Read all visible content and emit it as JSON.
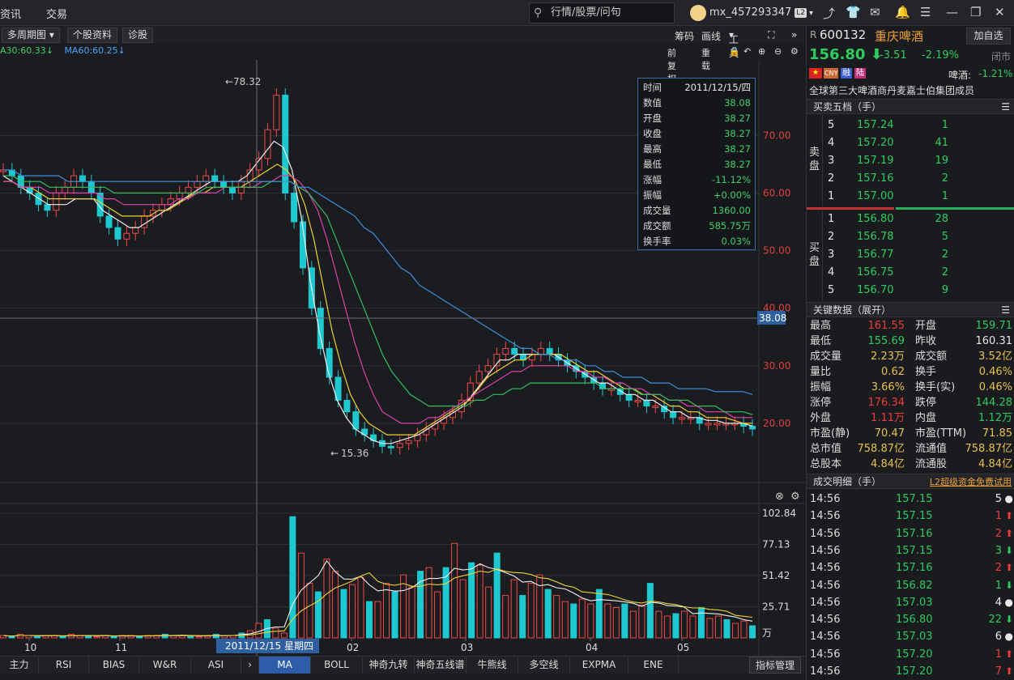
{
  "topnav": {
    "item1": "资讯",
    "item2": "交易"
  },
  "search": {
    "placeholder": "行情/股票/问句"
  },
  "user": {
    "name": "mx_457293347",
    "level": "L2"
  },
  "toolbar": {
    "period": "多周期图",
    "profile": "个股资料",
    "diagnose": "诊股",
    "chips": "筹码",
    "drawline": "画线",
    "tools": "工具"
  },
  "ma": {
    "ma30": "A30:60.33",
    "ma60": "MA60:60.25"
  },
  "chartctrl": {
    "restore": "前复权",
    "overlay": "重载"
  },
  "chart_data": {
    "type": "candlestick",
    "price_axis": [
      "70.00",
      "60.00",
      "50.00",
      "40.00",
      "30.00",
      "20.00"
    ],
    "current_price_label": "38.08",
    "high_marker": "78.32",
    "low_marker": "15.36",
    "volume_axis": [
      "102.84",
      "77.13",
      "51.42",
      "25.71",
      "万"
    ],
    "x_ticks": [
      "10",
      "11",
      "02",
      "03",
      "04",
      "05"
    ],
    "cursor_date": "2011/12/15 星期四",
    "series": [
      {
        "name": "close",
        "values": [
          64,
          63,
          61,
          60,
          58,
          57,
          60,
          61,
          63,
          62,
          60,
          56,
          54,
          52,
          53,
          54,
          56,
          57,
          58,
          59,
          60,
          61,
          62,
          63,
          62,
          61,
          60,
          62,
          64,
          66,
          71,
          77,
          60,
          55,
          47,
          40,
          33,
          28,
          24,
          22,
          19,
          18,
          17,
          16,
          15.8,
          16.5,
          17,
          18,
          19,
          20,
          21,
          22,
          24,
          27,
          29,
          30,
          32,
          33,
          32,
          31,
          32,
          33,
          32,
          31,
          30,
          29,
          28,
          27,
          26,
          26,
          25,
          24,
          24,
          23,
          23,
          22,
          21,
          21,
          21,
          20,
          20,
          20,
          20,
          20,
          19.5,
          19
        ]
      },
      {
        "name": "ma_white",
        "values": [
          63,
          62,
          61,
          60,
          59,
          58,
          58,
          58,
          59,
          59,
          59,
          57,
          56,
          55,
          54,
          54,
          55,
          56,
          57,
          58,
          59,
          60,
          61,
          62,
          62,
          62,
          62,
          63,
          65,
          67,
          69,
          68,
          64,
          56,
          45,
          36,
          29,
          24,
          21,
          19,
          18,
          17,
          16.5,
          16.5,
          17,
          17.5,
          18,
          19,
          20,
          21,
          22,
          23,
          25,
          27,
          29,
          31,
          31,
          32,
          32,
          32,
          32,
          32,
          31,
          30,
          29,
          28,
          27,
          27,
          26,
          25,
          25,
          24,
          24,
          23,
          22,
          22,
          21,
          21,
          20.5,
          20.5,
          20,
          20,
          20,
          19.5
        ]
      },
      {
        "name": "ma_yellow",
        "values": [
          62,
          62,
          61,
          61,
          60,
          59,
          59,
          59,
          59,
          59,
          59,
          58,
          57,
          56,
          56,
          56,
          56,
          57,
          57,
          58,
          59,
          60,
          60,
          61,
          61,
          61,
          61,
          62,
          63,
          64,
          65,
          64,
          62,
          58,
          52,
          44,
          36,
          30,
          25,
          22,
          20,
          19,
          18,
          18,
          18,
          18,
          19,
          20,
          21,
          22,
          23,
          24,
          26,
          28,
          29,
          30,
          31,
          31,
          32,
          32,
          32,
          32,
          31,
          30,
          29,
          29,
          28,
          27,
          26,
          26,
          25,
          25,
          24,
          23,
          23,
          22,
          22,
          21,
          21,
          21,
          20.5,
          20,
          20
        ]
      },
      {
        "name": "ma_pink",
        "values": [
          62,
          62,
          61,
          61,
          61,
          60,
          60,
          60,
          60,
          60,
          60,
          59,
          59,
          58,
          58,
          58,
          58,
          58,
          58,
          59,
          59,
          60,
          60,
          60,
          61,
          61,
          61,
          61,
          62,
          62,
          63,
          63,
          62,
          60,
          57,
          52,
          46,
          40,
          34,
          29,
          25,
          22,
          21,
          20,
          20,
          20,
          21,
          21,
          22,
          23,
          24,
          25,
          26,
          27,
          28,
          29,
          29,
          30,
          30,
          30,
          30,
          30,
          29,
          29,
          28,
          28,
          27,
          27,
          26,
          26,
          25,
          25,
          24,
          24,
          23,
          23,
          22,
          22,
          22,
          21,
          21,
          21
        ]
      },
      {
        "name": "ma_green",
        "values": [
          63,
          63,
          62,
          62,
          62,
          61,
          61,
          61,
          61,
          61,
          61,
          61,
          60,
          60,
          60,
          60,
          60,
          60,
          60,
          60,
          60,
          60,
          61,
          61,
          61,
          61,
          61,
          61,
          61,
          62,
          62,
          62,
          61,
          60,
          58,
          56,
          52,
          48,
          44,
          40,
          36,
          32,
          29,
          27,
          25,
          24,
          23,
          23,
          23,
          23,
          23,
          24,
          24,
          25,
          25,
          26,
          26,
          27,
          27,
          27,
          27,
          27,
          27,
          27,
          27,
          26,
          26,
          26,
          26,
          25,
          25,
          25,
          24,
          24,
          24,
          23,
          23,
          23,
          22,
          22,
          22,
          21.5
        ]
      },
      {
        "name": "ma30",
        "values": [
          64,
          64,
          63,
          63,
          63,
          63,
          63,
          62,
          62,
          62,
          62,
          62,
          62,
          62,
          62,
          62,
          62,
          62,
          62,
          62,
          62,
          62,
          62,
          62,
          62,
          62,
          62,
          62,
          62,
          62,
          62,
          62,
          61,
          61,
          60,
          59,
          58,
          57,
          56,
          54,
          53,
          51,
          49,
          47,
          46,
          44,
          43,
          42,
          41,
          40,
          39,
          38,
          37,
          36,
          35,
          34,
          33,
          33,
          32,
          32,
          31,
          31,
          31,
          30,
          30,
          29,
          29,
          28,
          28,
          28,
          27,
          27,
          27,
          26,
          26,
          26,
          26,
          25.5,
          25.5,
          25.5,
          25.5,
          25
        ]
      }
    ],
    "volume": [
      2,
      1,
      3,
      2,
      1,
      2,
      2,
      1,
      3,
      2,
      2,
      1,
      2,
      1,
      2,
      2,
      1,
      2,
      2,
      3,
      2,
      2,
      1,
      1,
      2,
      3,
      2,
      2,
      4,
      6,
      12,
      15,
      8,
      4,
      100,
      70,
      45,
      38,
      65,
      55,
      40,
      44,
      50,
      30,
      30,
      45,
      38,
      52,
      42,
      55,
      58,
      38,
      58,
      78,
      48,
      62,
      60,
      42,
      70,
      35,
      48,
      35,
      45,
      52,
      40,
      35,
      30,
      28,
      32,
      28,
      40,
      28,
      25,
      28,
      22,
      27,
      45,
      22,
      18,
      20,
      22,
      18,
      25,
      16,
      18,
      15,
      12,
      14,
      10
    ]
  },
  "infobox": {
    "rows": [
      {
        "k": "时间",
        "v": "2011/12/15/四"
      },
      {
        "k": "数值",
        "v": "38.08"
      },
      {
        "k": "开盘",
        "v": "38.27"
      },
      {
        "k": "收盘",
        "v": "38.27"
      },
      {
        "k": "最高",
        "v": "38.27"
      },
      {
        "k": "最低",
        "v": "38.27"
      },
      {
        "k": "涨幅",
        "v": "-11.12%"
      },
      {
        "k": "振幅",
        "v": "+0.00%"
      },
      {
        "k": "成交量",
        "v": "1360.00"
      },
      {
        "k": "成交额",
        "v": "585.75万"
      },
      {
        "k": "换手率",
        "v": "0.03%"
      }
    ]
  },
  "tabs": [
    "主力",
    "RSI",
    "BIAS",
    "W&R",
    "ASI",
    "MA",
    "BOLL",
    "神奇九转",
    "神奇五线谱",
    "牛熊线",
    "多空线",
    "EXPMA",
    "ENE"
  ],
  "tabs_right": "指标管理",
  "stock": {
    "flag": "R",
    "code": "600132",
    "name": "重庆啤酒",
    "add": "加自选",
    "price": "156.80",
    "change": "-3.51",
    "pct": "-2.19%",
    "status": "闭市",
    "sector": "啤酒:",
    "sector_pct": "-1.21%",
    "tag_cny": "CNY",
    "tag_rong": "融",
    "tag_lu": "陆",
    "desc": "全球第三大啤酒商丹麦嘉士伯集团成员"
  },
  "orderbook": {
    "title": "买卖五档（手）",
    "sell_label": "卖盘",
    "buy_label": "买盘",
    "sells": [
      {
        "lvl": "5",
        "p": "157.24",
        "v": "1"
      },
      {
        "lvl": "4",
        "p": "157.20",
        "v": "41"
      },
      {
        "lvl": "3",
        "p": "157.19",
        "v": "19"
      },
      {
        "lvl": "2",
        "p": "157.16",
        "v": "2"
      },
      {
        "lvl": "1",
        "p": "157.00",
        "v": "1"
      }
    ],
    "buys": [
      {
        "lvl": "1",
        "p": "156.80",
        "v": "28"
      },
      {
        "lvl": "2",
        "p": "156.78",
        "v": "5"
      },
      {
        "lvl": "3",
        "p": "156.77",
        "v": "2"
      },
      {
        "lvl": "4",
        "p": "156.75",
        "v": "2"
      },
      {
        "lvl": "5",
        "p": "156.70",
        "v": "9"
      }
    ]
  },
  "keydata": {
    "title": "关键数据（展开）",
    "rows": [
      {
        "k1": "最高",
        "v1": "161.55",
        "c1": "red",
        "k2": "开盘",
        "v2": "159.71",
        "c2": "green"
      },
      {
        "k1": "最低",
        "v1": "155.69",
        "c1": "green",
        "k2": "昨收",
        "v2": "160.31",
        "c2": "white"
      },
      {
        "k1": "成交量",
        "v1": "2.23万",
        "c1": "yellow",
        "k2": "成交额",
        "v2": "3.52亿",
        "c2": "yellow"
      },
      {
        "k1": "量比",
        "v1": "0.62",
        "c1": "yellow",
        "k2": "换手",
        "v2": "0.46%",
        "c2": "yellow"
      },
      {
        "k1": "振幅",
        "v1": "3.66%",
        "c1": "yellow",
        "k2": "换手(实)",
        "v2": "0.46%",
        "c2": "yellow"
      },
      {
        "k1": "涨停",
        "v1": "176.34",
        "c1": "red",
        "k2": "跌停",
        "v2": "144.28",
        "c2": "green"
      },
      {
        "k1": "外盘",
        "v1": "1.11万",
        "c1": "red",
        "k2": "内盘",
        "v2": "1.12万",
        "c2": "green"
      },
      {
        "k1": "市盈(静)",
        "v1": "70.47",
        "c1": "yellow",
        "k2": "市盈(TTM)",
        "v2": "71.85",
        "c2": "yellow"
      },
      {
        "k1": "总市值",
        "v1": "758.87亿",
        "c1": "yellow",
        "k2": "流通值",
        "v2": "758.87亿",
        "c2": "yellow"
      },
      {
        "k1": "总股本",
        "v1": "4.84亿",
        "c1": "yellow",
        "k2": "流通股",
        "v2": "4.84亿",
        "c2": "yellow"
      }
    ]
  },
  "trades": {
    "title": "成交明细（手）",
    "promo": "L2超级资金免费试用",
    "rows": [
      {
        "t": "14:56",
        "p": "157.15",
        "v": "5",
        "d": "flat",
        "pc": "green"
      },
      {
        "t": "14:56",
        "p": "157.15",
        "v": "1",
        "d": "up",
        "pc": "green"
      },
      {
        "t": "14:56",
        "p": "157.16",
        "v": "2",
        "d": "up",
        "pc": "green"
      },
      {
        "t": "14:56",
        "p": "157.15",
        "v": "3",
        "d": "down",
        "pc": "green"
      },
      {
        "t": "14:56",
        "p": "157.16",
        "v": "2",
        "d": "up",
        "pc": "green"
      },
      {
        "t": "14:56",
        "p": "156.82",
        "v": "1",
        "d": "down",
        "pc": "green"
      },
      {
        "t": "14:56",
        "p": "157.03",
        "v": "4",
        "d": "flat",
        "pc": "green"
      },
      {
        "t": "14:56",
        "p": "156.80",
        "v": "22",
        "d": "down",
        "pc": "green"
      },
      {
        "t": "14:56",
        "p": "157.03",
        "v": "6",
        "d": "flat",
        "pc": "green"
      },
      {
        "t": "14:56",
        "p": "157.20",
        "v": "1",
        "d": "up",
        "pc": "green"
      },
      {
        "t": "14:56",
        "p": "157.20",
        "v": "7",
        "d": "up",
        "pc": "green"
      }
    ]
  }
}
